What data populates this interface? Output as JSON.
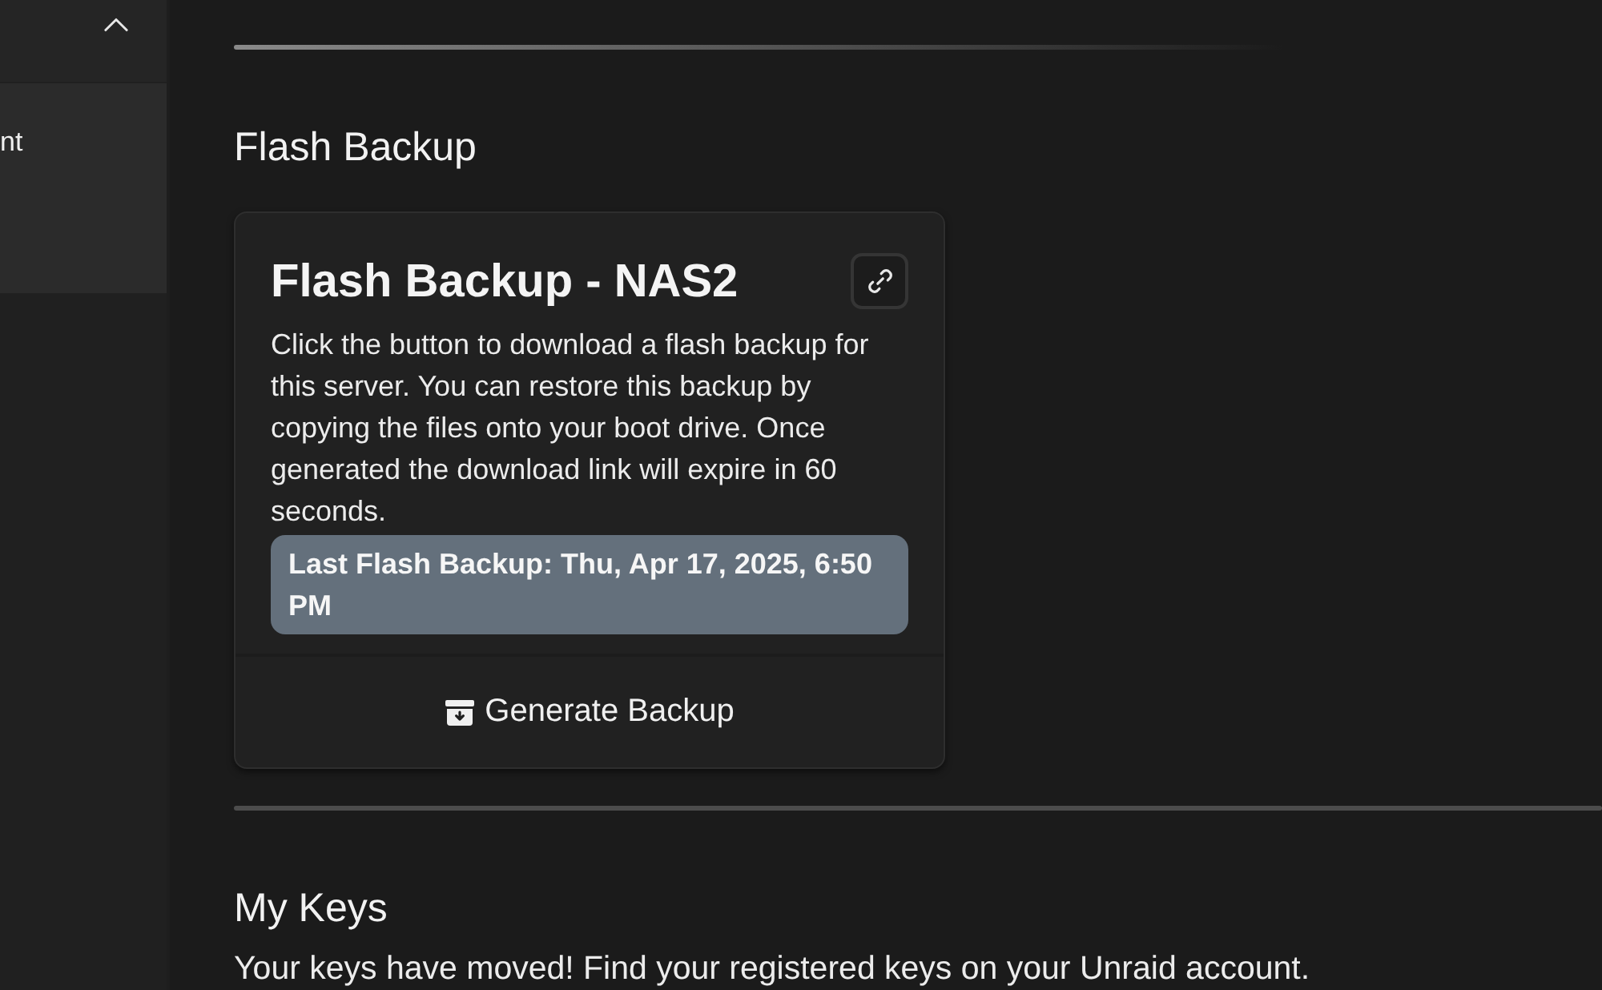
{
  "sidebar": {
    "expanded": true,
    "items": [
      {
        "label": "nt",
        "selected": true
      }
    ]
  },
  "sections": [
    {
      "kind": "card",
      "heading": "Flash Backup",
      "card": {
        "title": "Flash Backup - NAS2",
        "description": "Click the button to download a flash backup for this server. You can restore this backup by copying the files onto your boot drive. Once generated the download link will expire in 60 seconds.",
        "status": "Last Flash Backup: Thu, Apr 17, 2025, 6:50 PM",
        "button": "Generate Backup"
      }
    },
    {
      "kind": "text",
      "heading": "My Keys",
      "text": "Your keys have moved! Find your registered keys on your Unraid account."
    }
  ]
}
